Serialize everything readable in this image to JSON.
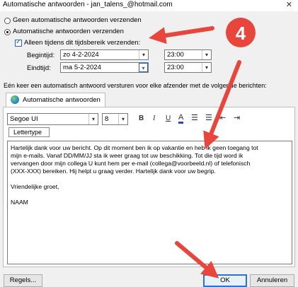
{
  "window": {
    "title": "Automatische antwoorden - jan_talens_@hotmail.com",
    "close_glyph": "✕"
  },
  "options": {
    "no_replies_label": "Geen automatische antwoorden verzenden",
    "send_replies_label": "Automatische antwoorden verzenden",
    "time_range_label": "Alleen tijdens dit tijdsbereik verzenden:",
    "start_label": "Begintijd:",
    "start_date": "zo 4-2-2024",
    "start_time": "23:00",
    "end_label": "Eindtijd:",
    "end_date": "ma 5-2-2024",
    "end_time": "23:00"
  },
  "once_label": "Eén keer een automatisch antwoord versturen voor elke afzender met de volgende berichten:",
  "tab": {
    "label": "Automatische antwoorden"
  },
  "toolbar": {
    "font": "Segoe UI",
    "size": "8",
    "bold": "B",
    "italic": "I",
    "underline": "U",
    "font_color": "A",
    "tooltip": "Lettertype"
  },
  "message": {
    "lines": [
      "Hartelijk dank voor uw bericht. Op dit moment ben ik op vakantie en heb ik geen toegang tot",
      "mijn e-mails. Vanaf DD/MM/JJ sta ik weer graag tot uw beschikking. Tot die tijd word ik",
      "vervangen door mijn collega U kunt hem per e-mail (collega@voorbeeld.nl) of telefonisch",
      "(XXX-XXX) bereiken. Hij helpt u graag verder. Hartelijk dank voor uw begrip.",
      "",
      "Vriendelijke groet,",
      "",
      "NAAM"
    ]
  },
  "annotation": {
    "number": "4"
  },
  "buttons": {
    "rules": "Regels...",
    "ok": "OK",
    "cancel": "Annuleren"
  },
  "colors": {
    "arrow": "#e8453c",
    "accent": "#2a63c7"
  }
}
